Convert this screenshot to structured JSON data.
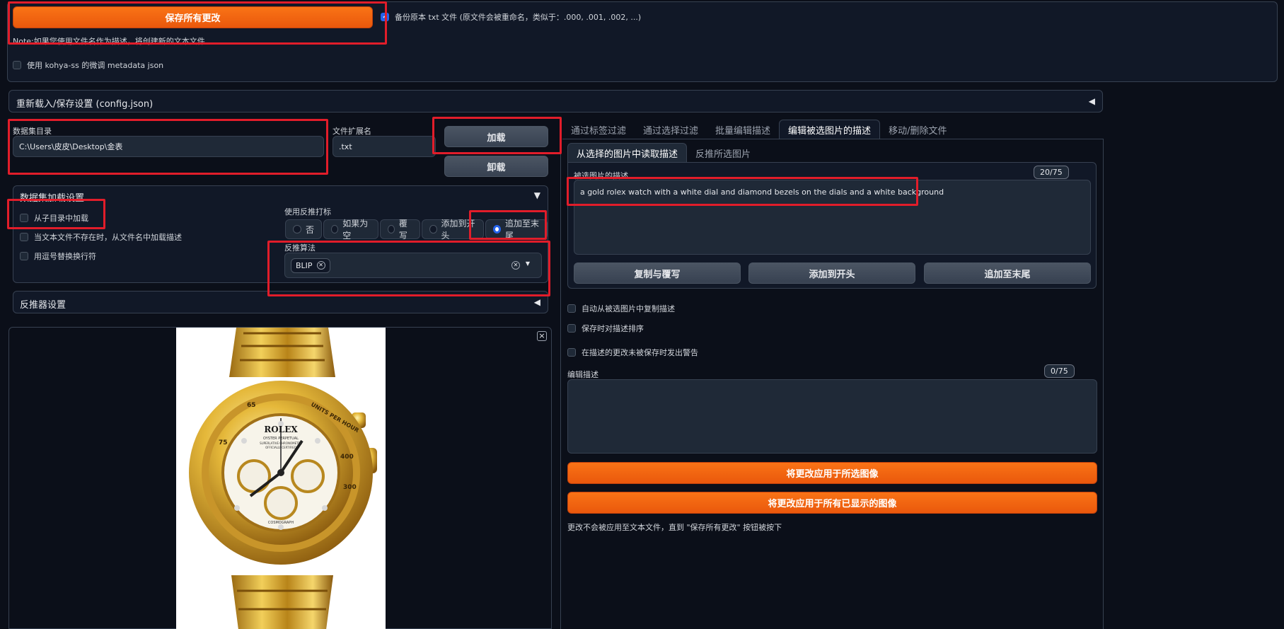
{
  "top": {
    "save_all_label": "保存所有更改",
    "backup_label": "备份原本 txt 文件 (原文件会被重命名，类似于：.000, .001, .002, ...)",
    "note": "Note:如果您使用文件名作为描述，将创建新的文本文件",
    "kohya_label": "使用 kohya-ss 的微调 metadata json"
  },
  "config_section": {
    "title": "重新载入/保存设置 (config.json)",
    "toggle": "◀"
  },
  "dataset": {
    "dir_label": "数据集目录",
    "dir_value": "C:\\Users\\皮皮\\Desktop\\金表",
    "ext_label": "文件扩展名",
    "ext_value": ".txt",
    "load_label": "加载",
    "unload_label": "卸载"
  },
  "load_settings": {
    "title": "数据集加载设置",
    "toggle": "▼",
    "subdir_label": "从子目录中加载",
    "from_filename_label": "当文本文件不存在时，从文件名中加载描述",
    "comma_label": "用逗号替换换行符",
    "interrogate_label": "使用反推打标",
    "options": [
      "否",
      "如果为空",
      "覆写",
      "添加到开头",
      "追加至末尾"
    ],
    "selected_option": "追加至末尾",
    "algo_label": "反推算法",
    "algo_chip": "BLIP"
  },
  "interrogator": {
    "title": "反推器设置",
    "toggle": "◀"
  },
  "image_preview": {
    "close": "×"
  },
  "tabs": [
    "通过标签过滤",
    "通过选择过滤",
    "批量编辑描述",
    "编辑被选图片的描述",
    "移动/删除文件"
  ],
  "active_tab": "编辑被选图片的描述",
  "subtabs": [
    "从选择的图片中读取描述",
    "反推所选图片"
  ],
  "selected_caption": {
    "label": "被选图片的描述",
    "counter": "20/75",
    "text": "a gold rolex watch with a white dial and diamond bezels on the dials and a white background"
  },
  "caption_buttons": {
    "copy": "复制与覆写",
    "prepend": "添加到开头",
    "append": "追加至末尾"
  },
  "options": {
    "auto_copy": "自动从被选图片中复制描述",
    "sort_on_save": "保存时对描述排序",
    "warn_unsaved": "在描述的更改未被保存时发出警告"
  },
  "edit_caption": {
    "label": "编辑描述",
    "counter": "0/75"
  },
  "apply": {
    "selected": "将更改应用于所选图像",
    "all": "将更改应用于所有已显示的图像",
    "note": "更改不会被应用至文本文件，直到 \"保存所有更改\" 按钮被按下"
  },
  "watch": {
    "brand": "ROLEX",
    "line1": "OYSTER PERPETUAL",
    "line2": "SUPERLATIVE CHRONOMETER",
    "line3": "OFFICIALLY CERTIFIED",
    "line4": "COSMOGRAPH",
    "bezel": "UNITS PER HOUR",
    "b1": "400",
    "b2": "300",
    "b3": "65",
    "b4": "75"
  },
  "colors": {
    "accent": "#f97316",
    "highlight": "#e11d2a",
    "bg": "#0b0f19",
    "panel": "#111827"
  }
}
